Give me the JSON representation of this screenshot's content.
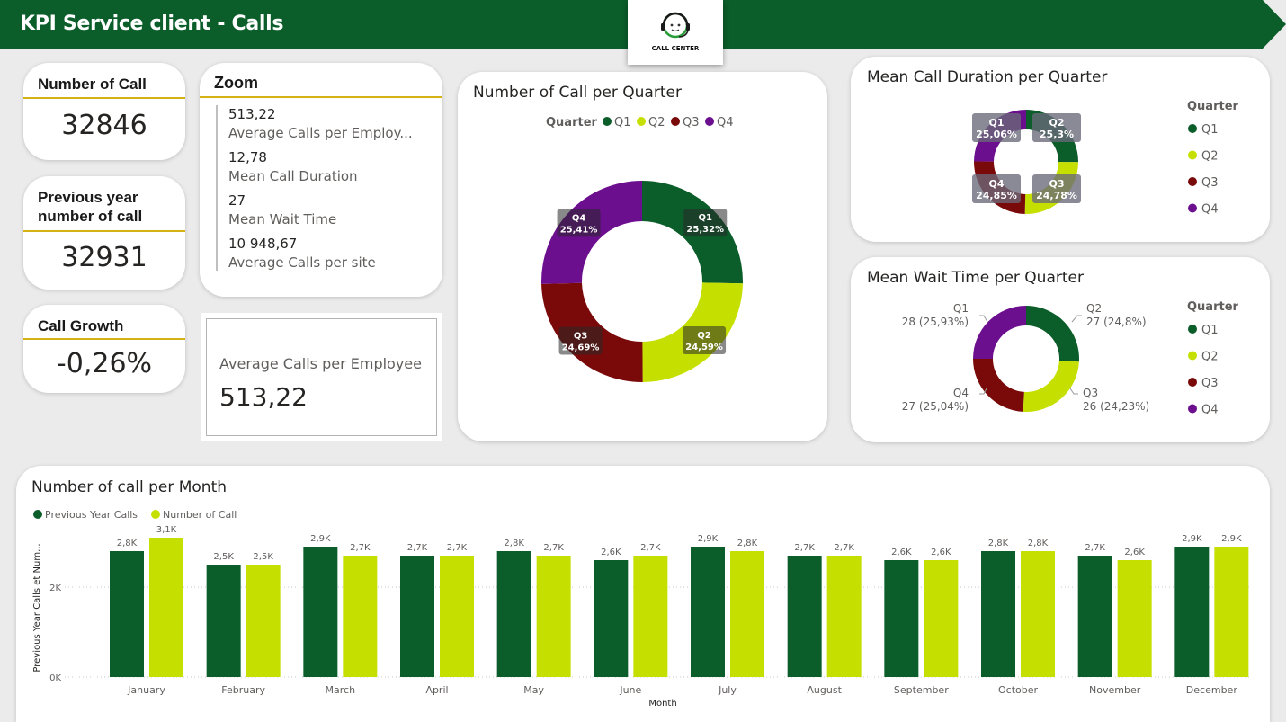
{
  "header": {
    "title": "KPI Service client - Calls",
    "logo_text": "CALL CENTER"
  },
  "colors": {
    "green_dark": "#0b5d2a",
    "lime": "#c5e000",
    "q1": "#0b5d2a",
    "q2": "#c5e000",
    "q3": "#7a0a0a",
    "q4": "#6c0f8f",
    "accent_line": "#d4b213"
  },
  "kpis": {
    "number_of_call": {
      "label": "Number of Call",
      "value": "32846"
    },
    "previous_year": {
      "label_line1": "Previous year",
      "label_line2": "number of call",
      "value": "32931"
    },
    "call_growth": {
      "label": "Call Growth",
      "value": "-0,26%"
    }
  },
  "zoom": {
    "title": "Zoom",
    "items": [
      {
        "value": "513,22",
        "label": "Average Calls per Employ..."
      },
      {
        "value": "12,78",
        "label": "Mean Call Duration"
      },
      {
        "value": "27",
        "label": "Mean Wait Time"
      },
      {
        "value": "10 948,67",
        "label": "Average Calls per site"
      }
    ]
  },
  "avg_card": {
    "label": "Average Calls per Employee",
    "value": "513,22"
  },
  "legend_title": "Quarter",
  "quarters": [
    "Q1",
    "Q2",
    "Q3",
    "Q4"
  ],
  "chart_data": [
    {
      "type": "pie",
      "title": "Number of Call per Quarter",
      "categories": [
        "Q1",
        "Q2",
        "Q3",
        "Q4"
      ],
      "values": [
        25.32,
        24.59,
        24.69,
        25.41
      ],
      "data_labels": [
        "25,32%",
        "24,59%",
        "24,69%",
        "25,41%"
      ],
      "legend_placement": "top"
    },
    {
      "type": "pie",
      "title": "Mean Call Duration per Quarter",
      "categories": [
        "Q1",
        "Q2",
        "Q3",
        "Q4"
      ],
      "values": [
        25.06,
        25.3,
        24.78,
        24.85
      ],
      "data_labels": [
        "25,06%",
        "25,3%",
        "24,78%",
        "24,85%"
      ],
      "legend_placement": "right"
    },
    {
      "type": "pie",
      "title": "Mean Wait Time per Quarter",
      "categories": [
        "Q1",
        "Q2",
        "Q3",
        "Q4"
      ],
      "values": [
        28,
        27,
        26,
        27
      ],
      "data_labels": [
        "28 (25,93%)",
        "27 (24,8%)",
        "26 (24,23%)",
        "27 (25,04%)"
      ],
      "legend_placement": "right"
    },
    {
      "type": "bar",
      "title": "Number of call per Month",
      "xlabel": "Month",
      "ylabel": "Previous Year Calls et Num...",
      "categories": [
        "January",
        "February",
        "March",
        "April",
        "May",
        "June",
        "July",
        "August",
        "September",
        "October",
        "November",
        "December"
      ],
      "series": [
        {
          "name": "Previous Year Calls",
          "values": [
            2800,
            2500,
            2900,
            2700,
            2800,
            2600,
            2900,
            2700,
            2600,
            2800,
            2700,
            2900
          ],
          "labels": [
            "2,8K",
            "2,5K",
            "2,9K",
            "2,7K",
            "2,8K",
            "2,6K",
            "2,9K",
            "2,7K",
            "2,6K",
            "2,8K",
            "2,7K",
            "2,9K"
          ]
        },
        {
          "name": "Number of Call",
          "values": [
            3100,
            2500,
            2700,
            2700,
            2700,
            2700,
            2800,
            2700,
            2600,
            2800,
            2600,
            2900
          ],
          "labels": [
            "3,1K",
            "2,5K",
            "2,7K",
            "2,7K",
            "2,7K",
            "2,7K",
            "2,8K",
            "2,7K",
            "2,6K",
            "2,8K",
            "2,6K",
            "2,9K"
          ]
        }
      ],
      "yticks": [
        "0K",
        "2K"
      ],
      "ylim": [
        0,
        3300
      ],
      "legend_placement": "top-left",
      "grid": true
    }
  ]
}
